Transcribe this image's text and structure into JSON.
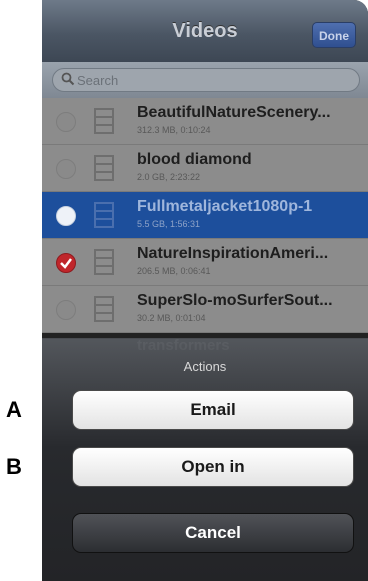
{
  "annotations": {
    "label_a": "A",
    "label_b": "B"
  },
  "navbar": {
    "title": "Videos",
    "done_label": "Done"
  },
  "search": {
    "placeholder": "Search"
  },
  "videos": [
    {
      "title": "BeautifulNatureScenery...",
      "subtitle": "312.3 MB, 0:10:24",
      "state": "unchecked"
    },
    {
      "title": "blood diamond",
      "subtitle": "2.0 GB, 2:23:22",
      "state": "unchecked"
    },
    {
      "title": "Fullmetaljacket1080p-1",
      "subtitle": "5.5 GB, 1:56:31",
      "state": "highlighted"
    },
    {
      "title": "NatureInspirationAmeri...",
      "subtitle": "206.5 MB, 0:06:41",
      "state": "checked"
    },
    {
      "title": "SuperSlo-moSurferSout...",
      "subtitle": "30.2 MB, 0:01:04",
      "state": "unchecked"
    }
  ],
  "partial_row_title": "transformers",
  "sheet": {
    "title": "Actions",
    "email_label": "Email",
    "open_in_label": "Open in",
    "cancel_label": "Cancel"
  },
  "icons": {
    "search": "search-icon",
    "file": "film-file-icon",
    "check": "checkmark-icon"
  }
}
